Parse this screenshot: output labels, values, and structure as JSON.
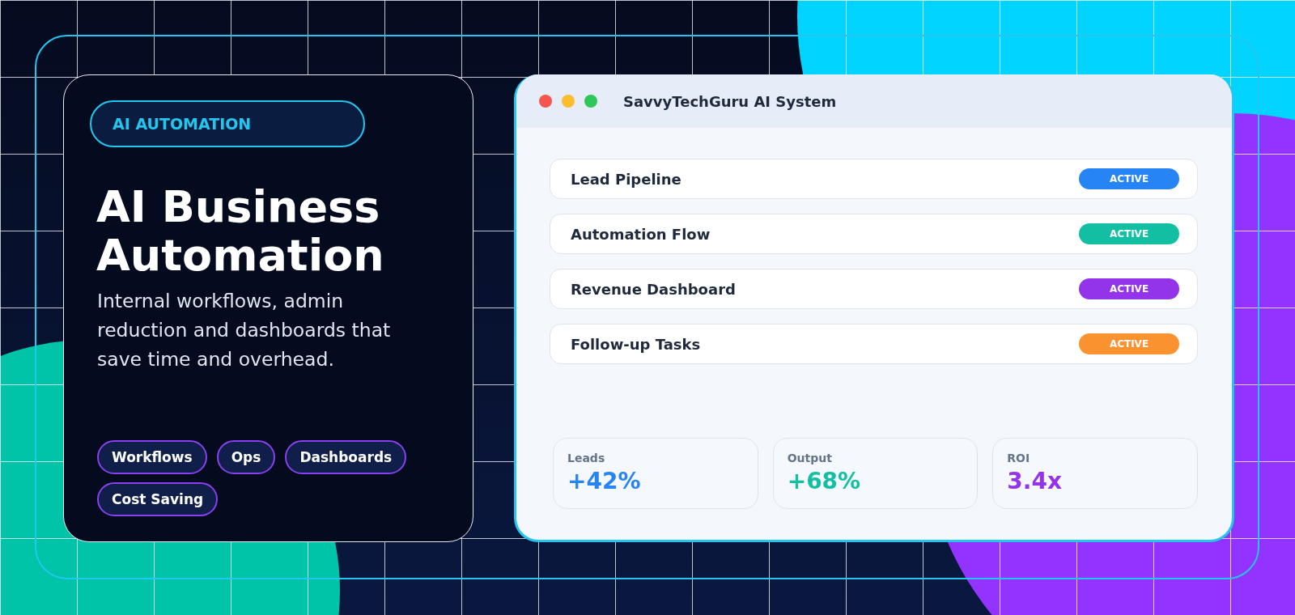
{
  "hero": {
    "chip": "AI AUTOMATION",
    "title": "AI Business Automation",
    "description": "Internal workflows, admin reduction and dashboards that save time and overhead.",
    "tags": [
      "Workflows",
      "Ops",
      "Dashboards",
      "Cost Saving"
    ]
  },
  "window": {
    "title": "SavvyTechGuru AI System",
    "rows": [
      {
        "label": "Lead Pipeline",
        "status": "ACTIVE",
        "color": "#2684f5"
      },
      {
        "label": "Automation Flow",
        "status": "ACTIVE",
        "color": "#12bfa3"
      },
      {
        "label": "Revenue Dashboard",
        "status": "ACTIVE",
        "color": "#9333ea"
      },
      {
        "label": "Follow-up Tasks",
        "status": "ACTIVE",
        "color": "#fb9230"
      }
    ],
    "stats": [
      {
        "label": "Leads",
        "value": "+42%",
        "color": "#2684f5"
      },
      {
        "label": "Output",
        "value": "+68%",
        "color": "#12bfa3"
      },
      {
        "label": "ROI",
        "value": "3.4x",
        "color": "#9333ea"
      }
    ]
  }
}
